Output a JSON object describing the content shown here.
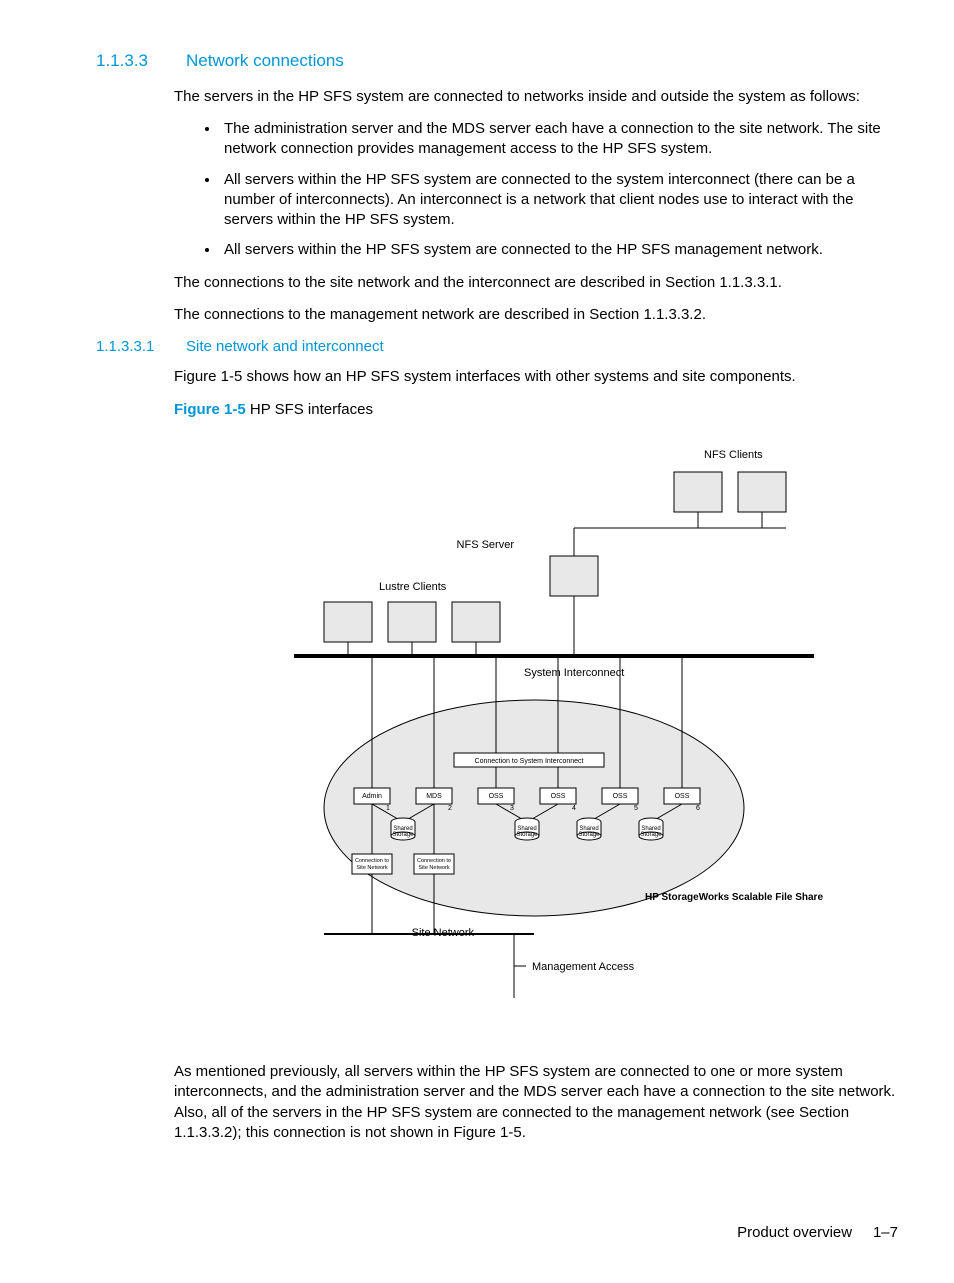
{
  "sec1": {
    "num": "1.1.3.3",
    "title": "Network connections"
  },
  "intro": "The servers in the HP SFS system are connected to networks inside and outside the system as follows:",
  "bullets": [
    "The administration server and the MDS server each have a connection to the site network. The site network connection provides management access to the HP SFS system.",
    "All servers within the HP SFS system are connected to the system interconnect (there can be a number of interconnects). An interconnect is a network that client nodes use to interact with the servers within the HP SFS system.",
    "All servers within the HP SFS system are connected to the HP SFS management network."
  ],
  "p2": "The connections to the site network and the interconnect are described in Section 1.1.3.3.1.",
  "p3": "The connections to the management network are described in Section 1.1.3.3.2.",
  "sec2": {
    "num": "1.1.3.3.1",
    "title": "Site network and interconnect"
  },
  "p4": "Figure 1-5 shows how an HP SFS system interfaces with other systems and site components.",
  "figlabel": "Figure 1-5",
  "figtitle": " HP SFS interfaces",
  "diagram": {
    "nfs_clients": "NFS Clients",
    "nfs_server": "NFS Server",
    "lustre_clients": "Lustre Clients",
    "sys_inter": "System Interconnect",
    "conn_si": "Connection to System Interconnect",
    "admin": "Admin",
    "mds": "MDS",
    "oss": "OSS",
    "n1": "1",
    "n2": "2",
    "n3": "3",
    "n4": "4",
    "n5": "5",
    "n6": "6",
    "shared": "Shared Storage",
    "conn_sn": "Connection to Site Network",
    "product": "HP StorageWorks Scalable File Share",
    "site_net": "Site Network",
    "mgmt": "Management Access"
  },
  "p5": "As mentioned previously, all servers within the HP SFS system are connected to one or more system interconnects, and the administration server and the MDS server each have a connection to the site network. Also, all of the servers in the HP SFS system are connected to the management network (see Section 1.1.3.3.2); this connection is not shown in Figure 1-5.",
  "footer": {
    "title": "Product overview",
    "page": "1–7"
  }
}
